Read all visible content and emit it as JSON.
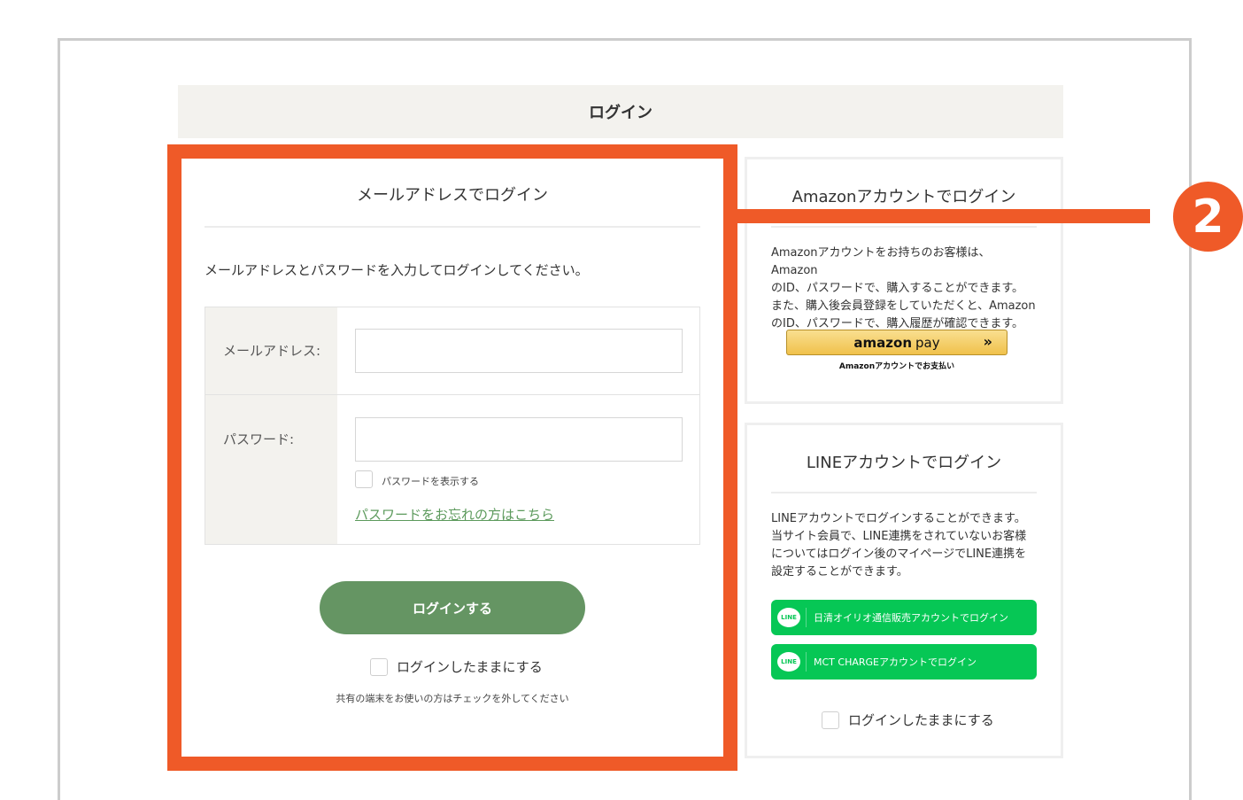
{
  "page": {
    "title": "ログイン"
  },
  "email_login": {
    "title": "メールアドレスでログイン",
    "intro": "メールアドレスとパスワードを入力してログインしてください。",
    "email_label": "メールアドレス:",
    "email_value": "",
    "password_label": "パスワード:",
    "password_value": "",
    "show_password_label": "パスワードを表示する",
    "forgot_link": "パスワードをお忘れの方はこちら",
    "submit_label": "ログインする",
    "remember_label": "ログインしたままにする",
    "shared_note": "共有の端末をお使いの方はチェックを外してください"
  },
  "amazon_login": {
    "title": "Amazonアカウントでログイン",
    "description": [
      "Amazonアカウントをお持ちのお客様は、Amazon",
      "のID、パスワードで、購入することができます。",
      "また、購入後会員登録をしていただくと、Amazon",
      "のID、パスワードで、購入履歴が確認できます。"
    ],
    "button_logo": "amazon",
    "button_pay": "pay",
    "button_arrow": "»",
    "button_caption": "Amazonアカウントでお支払い"
  },
  "line_login": {
    "title": "LINEアカウントでログイン",
    "description": [
      "LINEアカウントでログインすることができます。",
      "当サイト会員で、LINE連携をされていないお客様",
      "についてはログイン後のマイページでLINE連携を",
      "設定することができます。"
    ],
    "icon_text": "LINE",
    "button_nisshin": "日清オイリオ通信販売アカウントでログイン",
    "button_mct": "MCT CHARGEアカウントでログイン",
    "remember_label": "ログインしたままにする"
  },
  "annotation": {
    "badge_number": "2"
  },
  "colors": {
    "accent": "#ef5a28",
    "button_green": "#659563",
    "line_green": "#06c755",
    "link_green": "#5c9a5c"
  }
}
